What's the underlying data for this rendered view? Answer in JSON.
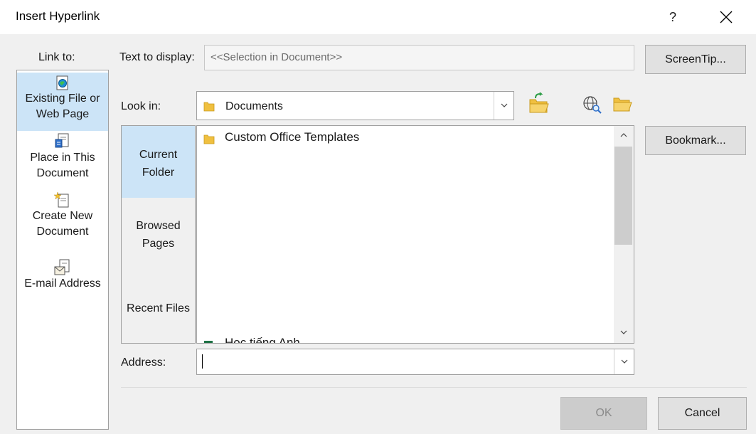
{
  "dialog": {
    "title": "Insert Hyperlink",
    "help_glyph": "?",
    "close_glyph": "×"
  },
  "link_to": {
    "label": "Link to:",
    "items": [
      {
        "line1": "Existing File or",
        "line2": "Web Page",
        "icon": "existing-file-icon",
        "selected": true
      },
      {
        "line1": "Place in This",
        "line2": "Document",
        "icon": "place-in-document-icon",
        "selected": false
      },
      {
        "line1": "Create New",
        "line2": "Document",
        "icon": "create-new-document-icon",
        "selected": false
      },
      {
        "line1": "E-mail Address",
        "line2": "",
        "icon": "email-address-icon",
        "selected": false
      }
    ]
  },
  "text_to_display": {
    "label": "Text to display:",
    "value": "<<Selection in Document>>"
  },
  "buttons": {
    "screentip": "ScreenTip...",
    "bookmark": "Bookmark...",
    "ok": "OK",
    "cancel": "Cancel"
  },
  "look_in": {
    "label": "Look in:",
    "value": "Documents"
  },
  "nav": {
    "current_line1": "Current",
    "current_line2": "Folder",
    "browsed_line1": "Browsed",
    "browsed_line2": "Pages",
    "recent": "Recent Files"
  },
  "files": {
    "items": [
      "Custom Office Templates"
    ],
    "partial_item": "Học tiếng Anh"
  },
  "address": {
    "label": "Address:",
    "value": ""
  },
  "colors": {
    "selection": "#cce4f7",
    "dialog_bg": "#f0f0f0",
    "folder": "#f0c040"
  }
}
